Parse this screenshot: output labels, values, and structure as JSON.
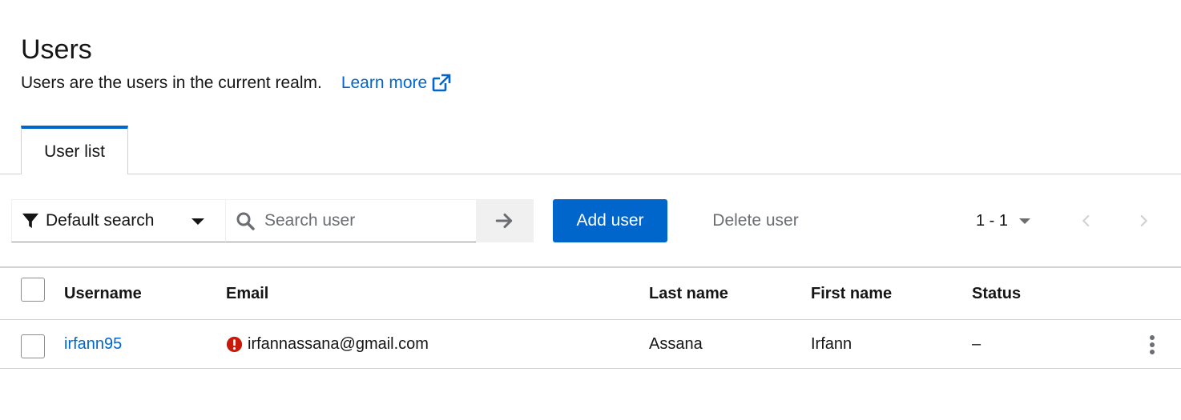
{
  "header": {
    "title": "Users",
    "description": "Users are the users in the current realm.",
    "learn_more": "Learn more",
    "learn_more_icon": "external-link-icon"
  },
  "tabs": [
    {
      "label": "User list",
      "active": true
    }
  ],
  "toolbar": {
    "filter_label": "Default search",
    "filter_icon": "filter-icon",
    "search_placeholder": "Search user",
    "search_value": "",
    "add_user_label": "Add user",
    "delete_user_label": "Delete user",
    "pagination_label": "1 - 1"
  },
  "table": {
    "columns": [
      "Username",
      "Email",
      "Last name",
      "First name",
      "Status"
    ],
    "rows": [
      {
        "username": "irfann95",
        "email": "irfannassana@gmail.com",
        "email_icon": "exclamation-circle-icon",
        "last_name": "Assana",
        "first_name": "Irfann",
        "status": "–"
      }
    ]
  },
  "colors": {
    "accent": "#0066cc",
    "warning": "#c9190b",
    "border": "#d2d2d2"
  }
}
